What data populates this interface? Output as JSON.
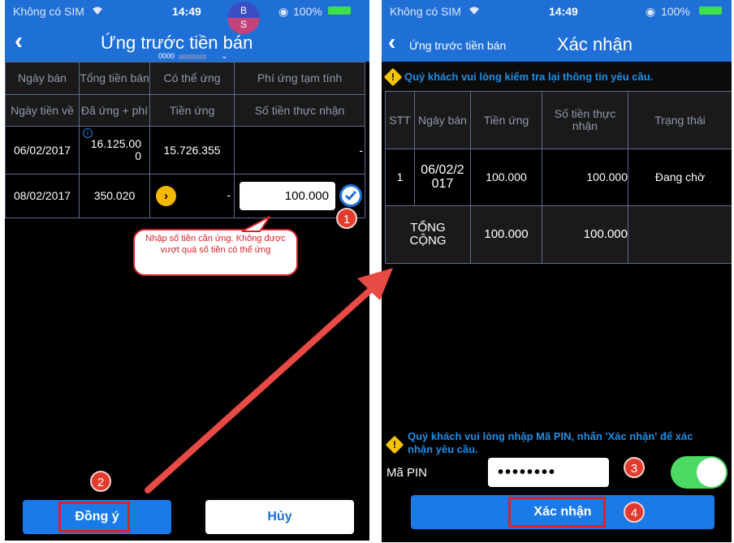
{
  "left": {
    "status": {
      "carrier": "Không có SIM",
      "time": "14:49",
      "battery": "100%",
      "bubble_top": "B",
      "bubble_bottom": "S"
    },
    "header": {
      "title": "Ứng trước tiền bán",
      "account": "0000"
    },
    "table": {
      "header_row1": [
        "Ngày bán",
        "Tổng tiền bán",
        "Có thể ứng",
        "Phí ứng tạm tính"
      ],
      "header_row2": [
        "Ngày tiền về",
        "Đã ứng + phí",
        "Tiền ứng",
        "Số tiền thực nhận"
      ],
      "rows": [
        {
          "date": "06/02/2017",
          "total": "16.125.000",
          "available": "15.726.355",
          "fee": "-"
        },
        {
          "date": "08/02/2017",
          "total": "350.020",
          "advance_placeholder": "-",
          "amount_input": "100.000"
        }
      ]
    },
    "tooltip": "Nhập số tiền cần ứng. Không được vượt quá số tiền có thể ứng",
    "buttons": {
      "agree": "Đồng ý",
      "cancel": "Hủy"
    },
    "steps": {
      "one": "1",
      "two": "2"
    }
  },
  "right": {
    "status": {
      "carrier": "Không có SIM",
      "time": "14:49",
      "battery": "100%"
    },
    "header": {
      "back_label": "Ứng trước tiền bán",
      "title": "Xác nhận"
    },
    "notice_top": "Quý khách vui lòng kiểm tra lại thông tin yêu cầu.",
    "table": {
      "headers": [
        "STT",
        "Ngày bán",
        "Tiền ứng",
        "Số tiền thực nhận",
        "Trạng thái"
      ],
      "row": {
        "stt": "1",
        "date": "06/02/2017",
        "advance": "100.000",
        "received": "100.000",
        "status": "Đang chờ"
      },
      "total": {
        "label": "TỔNG CỘNG",
        "advance": "100.000",
        "received": "100.000"
      }
    },
    "notice_bottom": "Quý khách vui lòng nhập Mã PIN, nhấn 'Xác nhận' để xác nhận yêu cầu.",
    "pin": {
      "label": "Mã PIN",
      "value": "••••••••"
    },
    "confirm_button": "Xác nhận",
    "steps": {
      "three": "3",
      "four": "4"
    }
  },
  "colors": {
    "header_blue": "#1e6fd6",
    "button_blue": "#1a7be8",
    "accent_red": "#d8232a",
    "arrow_red": "#e84a45",
    "toggle_green": "#4cd964"
  }
}
